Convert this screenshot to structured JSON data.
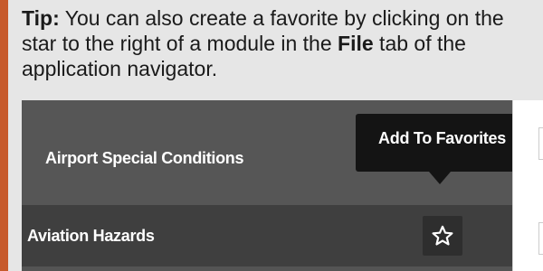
{
  "tip": {
    "label": "Tip:",
    "text_before_bold": " You can also create a favorite by clicking on the star to the right of a module in the ",
    "bold_word": "File",
    "text_after_bold": " tab of the application navigator."
  },
  "navigator": {
    "items": [
      {
        "label": "Airport Special Conditions"
      },
      {
        "label": "Aviation Hazards",
        "action_icon": "star-outline-icon"
      }
    ],
    "tooltip": "Add To Favorites"
  },
  "colors": {
    "accent": "#c75a2c",
    "tip_background": "#e6e6e6",
    "nav_background": "#565656",
    "nav_selected": "#3f3f3f",
    "tooltip_background": "#141414"
  }
}
